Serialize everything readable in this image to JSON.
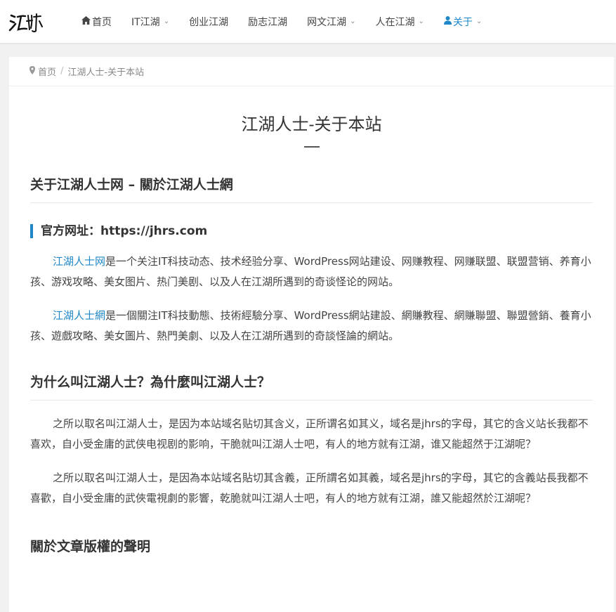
{
  "header": {
    "nav": [
      {
        "label": "首页",
        "icon": "home-icon",
        "dropdown": false
      },
      {
        "label": "IT江湖",
        "dropdown": true
      },
      {
        "label": "创业江湖",
        "dropdown": false
      },
      {
        "label": "励志江湖",
        "dropdown": false
      },
      {
        "label": "网文江湖",
        "dropdown": true
      },
      {
        "label": "人在江湖",
        "dropdown": true
      },
      {
        "label": "关于",
        "icon": "user-icon",
        "dropdown": true,
        "active": true
      }
    ]
  },
  "breadcrumb": {
    "home": "首页",
    "current": "江湖人士-关于本站"
  },
  "page": {
    "title": "江湖人士-关于本站"
  },
  "article": {
    "h2_about": "关于江湖人士网 – 關於江湖人士網",
    "h3_url": "官方网址：https://jhrs.com",
    "p1_link": "江湖人士网",
    "p1_text": "是一个关注IT科技动态、技术经验分享、WordPress网站建设、网赚教程、网赚联盟、联盟营销、养育小孩、游戏攻略、美女图片、热门美剧、以及人在江湖所遇到的奇谈怪论的网站。",
    "p2_link": "江湖人士網",
    "p2_text": "是一個關注IT科技動態、技術經驗分享、WordPress網站建設、網賺教程、網賺聯盟、聯盟營銷、養育小孩、遊戲攻略、美女圖片、熱門美劇、以及人在江湖所遇到的奇談怪論的網站。",
    "h2_why": "为什么叫江湖人士？為什麼叫江湖人士？",
    "p3": "之所以取名叫江湖人士，是因为本站域名贴切其含义，正所谓名如其义，域名是jhrs的字母，其它的含义站长我都不喜欢，自小受金庸的武侠电视剧的影响，干脆就叫江湖人士吧，有人的地方就有江湖，谁又能超然于江湖呢？",
    "p4": "之所以取名叫江湖人士，是因為本站域名貼切其含義，正所謂名如其義，域名是jhrs的字母，其它的含義站長我都不喜歡，自小受金庸的武俠電視劇的影響，乾脆就叫江湖人士吧，有人的地方就有江湖，誰又能超然於江湖呢？",
    "h2_copyright": "關於文章版權的聲明"
  },
  "colors": {
    "accent": "#1e87c7",
    "background": "#f1f1f1"
  }
}
